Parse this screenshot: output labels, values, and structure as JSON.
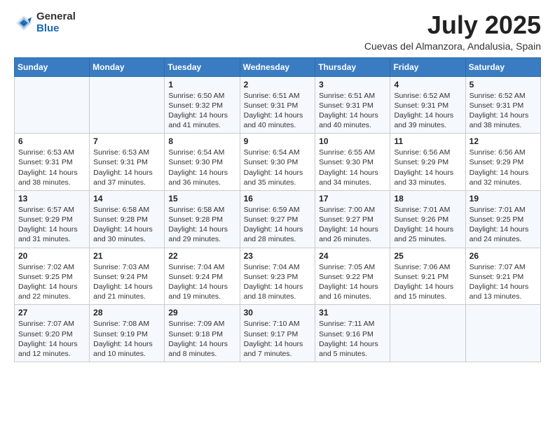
{
  "logo": {
    "general": "General",
    "blue": "Blue"
  },
  "title": "July 2025",
  "subtitle": "Cuevas del Almanzora, Andalusia, Spain",
  "days_of_week": [
    "Sunday",
    "Monday",
    "Tuesday",
    "Wednesday",
    "Thursday",
    "Friday",
    "Saturday"
  ],
  "weeks": [
    [
      {
        "day": "",
        "info": ""
      },
      {
        "day": "",
        "info": ""
      },
      {
        "day": "1",
        "info": "Sunrise: 6:50 AM\nSunset: 9:32 PM\nDaylight: 14 hours and 41 minutes."
      },
      {
        "day": "2",
        "info": "Sunrise: 6:51 AM\nSunset: 9:31 PM\nDaylight: 14 hours and 40 minutes."
      },
      {
        "day": "3",
        "info": "Sunrise: 6:51 AM\nSunset: 9:31 PM\nDaylight: 14 hours and 40 minutes."
      },
      {
        "day": "4",
        "info": "Sunrise: 6:52 AM\nSunset: 9:31 PM\nDaylight: 14 hours and 39 minutes."
      },
      {
        "day": "5",
        "info": "Sunrise: 6:52 AM\nSunset: 9:31 PM\nDaylight: 14 hours and 38 minutes."
      }
    ],
    [
      {
        "day": "6",
        "info": "Sunrise: 6:53 AM\nSunset: 9:31 PM\nDaylight: 14 hours and 38 minutes."
      },
      {
        "day": "7",
        "info": "Sunrise: 6:53 AM\nSunset: 9:31 PM\nDaylight: 14 hours and 37 minutes."
      },
      {
        "day": "8",
        "info": "Sunrise: 6:54 AM\nSunset: 9:30 PM\nDaylight: 14 hours and 36 minutes."
      },
      {
        "day": "9",
        "info": "Sunrise: 6:54 AM\nSunset: 9:30 PM\nDaylight: 14 hours and 35 minutes."
      },
      {
        "day": "10",
        "info": "Sunrise: 6:55 AM\nSunset: 9:30 PM\nDaylight: 14 hours and 34 minutes."
      },
      {
        "day": "11",
        "info": "Sunrise: 6:56 AM\nSunset: 9:29 PM\nDaylight: 14 hours and 33 minutes."
      },
      {
        "day": "12",
        "info": "Sunrise: 6:56 AM\nSunset: 9:29 PM\nDaylight: 14 hours and 32 minutes."
      }
    ],
    [
      {
        "day": "13",
        "info": "Sunrise: 6:57 AM\nSunset: 9:29 PM\nDaylight: 14 hours and 31 minutes."
      },
      {
        "day": "14",
        "info": "Sunrise: 6:58 AM\nSunset: 9:28 PM\nDaylight: 14 hours and 30 minutes."
      },
      {
        "day": "15",
        "info": "Sunrise: 6:58 AM\nSunset: 9:28 PM\nDaylight: 14 hours and 29 minutes."
      },
      {
        "day": "16",
        "info": "Sunrise: 6:59 AM\nSunset: 9:27 PM\nDaylight: 14 hours and 28 minutes."
      },
      {
        "day": "17",
        "info": "Sunrise: 7:00 AM\nSunset: 9:27 PM\nDaylight: 14 hours and 26 minutes."
      },
      {
        "day": "18",
        "info": "Sunrise: 7:01 AM\nSunset: 9:26 PM\nDaylight: 14 hours and 25 minutes."
      },
      {
        "day": "19",
        "info": "Sunrise: 7:01 AM\nSunset: 9:25 PM\nDaylight: 14 hours and 24 minutes."
      }
    ],
    [
      {
        "day": "20",
        "info": "Sunrise: 7:02 AM\nSunset: 9:25 PM\nDaylight: 14 hours and 22 minutes."
      },
      {
        "day": "21",
        "info": "Sunrise: 7:03 AM\nSunset: 9:24 PM\nDaylight: 14 hours and 21 minutes."
      },
      {
        "day": "22",
        "info": "Sunrise: 7:04 AM\nSunset: 9:24 PM\nDaylight: 14 hours and 19 minutes."
      },
      {
        "day": "23",
        "info": "Sunrise: 7:04 AM\nSunset: 9:23 PM\nDaylight: 14 hours and 18 minutes."
      },
      {
        "day": "24",
        "info": "Sunrise: 7:05 AM\nSunset: 9:22 PM\nDaylight: 14 hours and 16 minutes."
      },
      {
        "day": "25",
        "info": "Sunrise: 7:06 AM\nSunset: 9:21 PM\nDaylight: 14 hours and 15 minutes."
      },
      {
        "day": "26",
        "info": "Sunrise: 7:07 AM\nSunset: 9:21 PM\nDaylight: 14 hours and 13 minutes."
      }
    ],
    [
      {
        "day": "27",
        "info": "Sunrise: 7:07 AM\nSunset: 9:20 PM\nDaylight: 14 hours and 12 minutes."
      },
      {
        "day": "28",
        "info": "Sunrise: 7:08 AM\nSunset: 9:19 PM\nDaylight: 14 hours and 10 minutes."
      },
      {
        "day": "29",
        "info": "Sunrise: 7:09 AM\nSunset: 9:18 PM\nDaylight: 14 hours and 8 minutes."
      },
      {
        "day": "30",
        "info": "Sunrise: 7:10 AM\nSunset: 9:17 PM\nDaylight: 14 hours and 7 minutes."
      },
      {
        "day": "31",
        "info": "Sunrise: 7:11 AM\nSunset: 9:16 PM\nDaylight: 14 hours and 5 minutes."
      },
      {
        "day": "",
        "info": ""
      },
      {
        "day": "",
        "info": ""
      }
    ]
  ]
}
